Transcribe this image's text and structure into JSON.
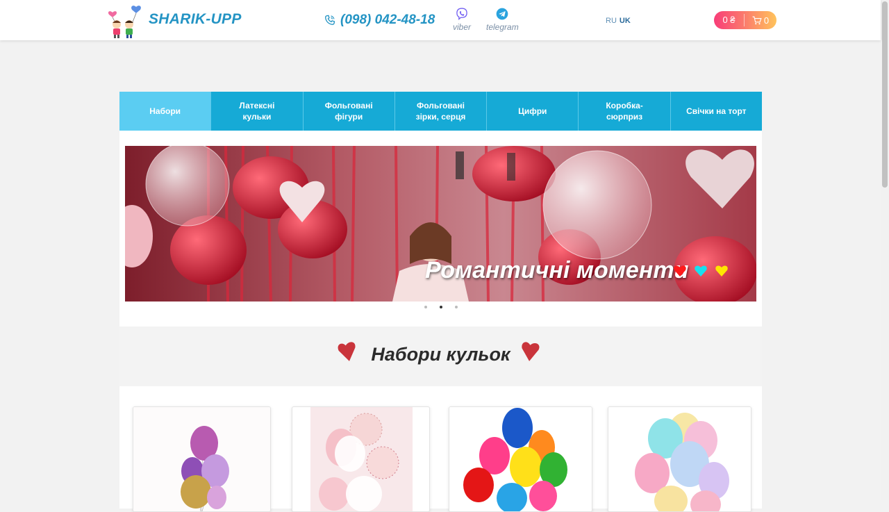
{
  "header": {
    "logo_text": "SHARIK-UPP",
    "phone": "(098) 042-48-18",
    "viber_label": "viber",
    "telegram_label": "telegram",
    "lang_ru": "RU",
    "lang_uk": "UK",
    "cart_sum": "0 ₴",
    "cart_count": "0"
  },
  "nav": {
    "items": [
      {
        "label": "Набори"
      },
      {
        "label": "Латексні кульки"
      },
      {
        "label": "Фольговані фігури"
      },
      {
        "label": "Фольговані зірки, серця"
      },
      {
        "label": "Цифри"
      },
      {
        "label": "Коробка-сюрприз"
      },
      {
        "label": "Свічки на торт"
      }
    ]
  },
  "banner": {
    "caption": "Романтичні моменти",
    "active_slide": 2,
    "slide_count": 3
  },
  "section": {
    "title": "Набори кульок"
  },
  "colors": {
    "brand_blue": "#2494c4",
    "nav_bg": "#16aad6",
    "nav_active": "#5bcdf2",
    "heart_red": "#c9343b"
  }
}
